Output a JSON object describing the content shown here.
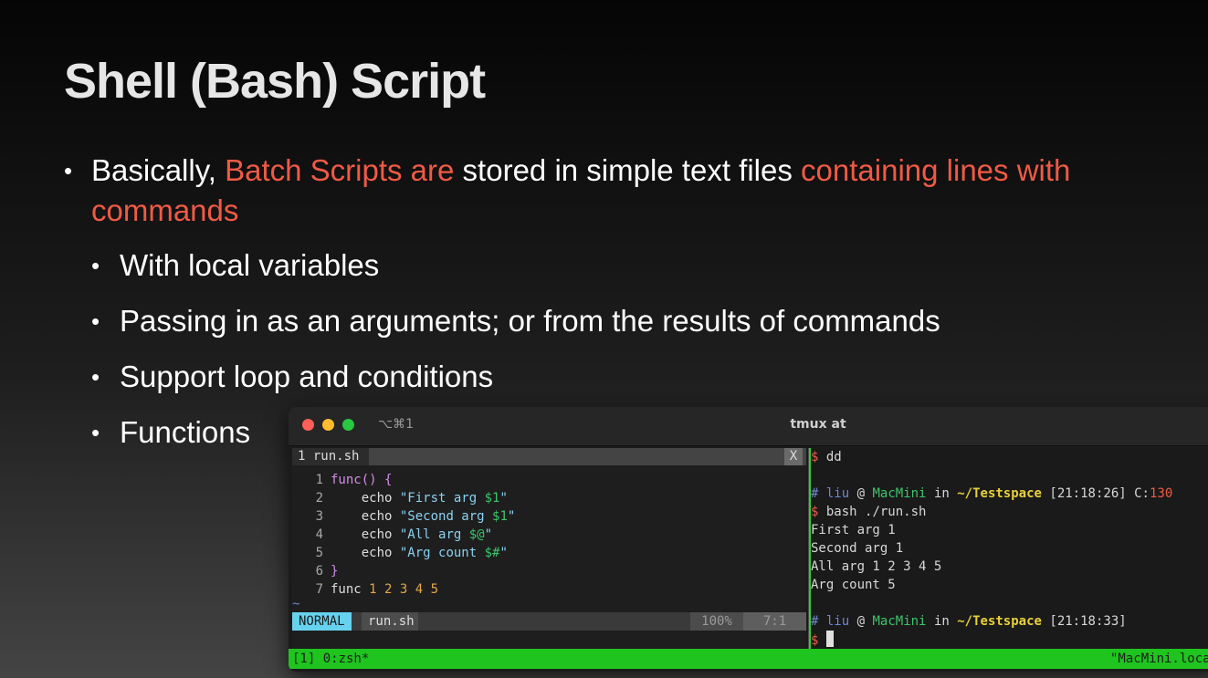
{
  "slide": {
    "title": "Shell (Bash) Script",
    "bullet_symbol": "•",
    "main_bullet": {
      "part1": "Basically, ",
      "part2": "Batch Scripts are",
      "part3": " stored in simple text files ",
      "part4": "containing lines with commands"
    },
    "sub_bullets": [
      "With local variables",
      "Passing in as an arguments; or from the results of commands",
      "Support loop and conditions",
      "Functions"
    ],
    "highlight_color": "#f05a45"
  },
  "terminal": {
    "tab_shortcut": "⌥⌘1",
    "title": "tmux at",
    "editor": {
      "buffer_name": "1 run.sh",
      "close_label": "X",
      "lines": [
        {
          "num": "1",
          "a": "func() {"
        },
        {
          "num": "2",
          "kw": "echo",
          "str": "\"First arg ",
          "var": "$1",
          "end": "\""
        },
        {
          "num": "3",
          "kw": "echo",
          "str": "\"Second arg ",
          "var": "$1",
          "end": "\""
        },
        {
          "num": "4",
          "kw": "echo",
          "str": "\"All arg ",
          "var": "$@",
          "end": "\""
        },
        {
          "num": "5",
          "kw": "echo",
          "str": "\"Arg count ",
          "var": "$#",
          "end": "\""
        },
        {
          "num": "6",
          "a": "}"
        },
        {
          "num": "7",
          "a": "func",
          "args": "1 2 3 4 5"
        }
      ],
      "tilde": "~",
      "mode": "NORMAL",
      "status_file": "run.sh",
      "percent": "100%",
      "position": "7:1"
    },
    "shell": {
      "prompt_symbol": "$",
      "hash": "#",
      "first_cmd": "dd",
      "user": "liu",
      "at": "@",
      "host": "MacMini",
      "in": "in",
      "path": "~/Testspace",
      "time1": "[21:18:26]",
      "code_label": "C:",
      "code_value": "130",
      "second_cmd": "bash ./run.sh",
      "output": [
        "First arg 1",
        "Second arg 1",
        "All arg 1 2 3 4 5",
        "Arg count 5"
      ],
      "time2": "[21:18:33]"
    },
    "tmux": {
      "left": "[1] 0:zsh*",
      "right": "\"MacMini.local\""
    },
    "colors": {
      "tmux_bar": "#1fc41f",
      "mode_badge": "#66d2ee",
      "string": "#8ad1f0",
      "variable": "#3ec46a",
      "path": "#e8d03a"
    }
  }
}
